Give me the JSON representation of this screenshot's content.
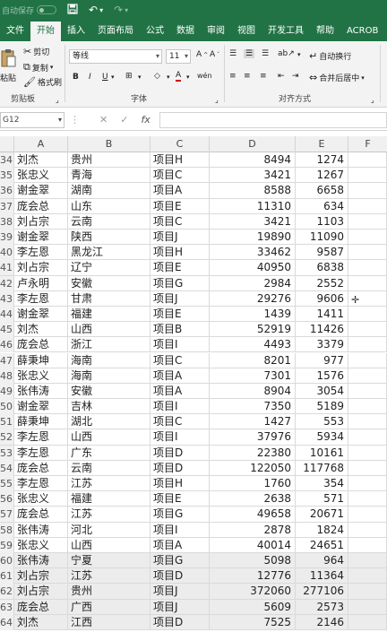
{
  "title_bar": {
    "autosave_label": "自动保存",
    "autosave_state": "关",
    "icons": [
      "save-icon",
      "undo-icon",
      "redo-icon"
    ]
  },
  "tabs": [
    "文件",
    "开始",
    "插入",
    "页面布局",
    "公式",
    "数据",
    "审阅",
    "视图",
    "开发工具",
    "帮助",
    "ACROB"
  ],
  "active_tab": "开始",
  "ribbon": {
    "clipboard": {
      "paste": "粘贴",
      "cut": "剪切",
      "copy": "复制",
      "format_painter": "格式刷",
      "label": "剪贴板"
    },
    "font": {
      "name": "等线",
      "size": "11",
      "label": "字体"
    },
    "alignment": {
      "wrap": "自动换行",
      "merge": "合并后居中",
      "label": "对齐方式"
    }
  },
  "formula_bar": {
    "name_box": "G12",
    "fx": "fx"
  },
  "columns": [
    "A",
    "B",
    "C",
    "D",
    "E",
    "F"
  ],
  "rows": [
    {
      "n": "34",
      "a": "刘杰",
      "b": "贵州",
      "c": "项目H",
      "d": "8494",
      "e": "1274",
      "shade": false
    },
    {
      "n": "35",
      "a": "张忠义",
      "b": "青海",
      "c": "项目C",
      "d": "3421",
      "e": "1267",
      "shade": false
    },
    {
      "n": "36",
      "a": "谢金翠",
      "b": "湖南",
      "c": "项目A",
      "d": "8588",
      "e": "6658",
      "shade": false
    },
    {
      "n": "37",
      "a": "庞会总",
      "b": "山东",
      "c": "项目E",
      "d": "11310",
      "e": "634",
      "shade": false
    },
    {
      "n": "38",
      "a": "刘占宗",
      "b": "云南",
      "c": "项目C",
      "d": "3421",
      "e": "1103",
      "shade": false
    },
    {
      "n": "39",
      "a": "谢金翠",
      "b": "陕西",
      "c": "项目J",
      "d": "19890",
      "e": "11090",
      "shade": false
    },
    {
      "n": "40",
      "a": "李左恩",
      "b": "黑龙江",
      "c": "项目H",
      "d": "33462",
      "e": "9587",
      "shade": false
    },
    {
      "n": "41",
      "a": "刘占宗",
      "b": "辽宁",
      "c": "项目E",
      "d": "40950",
      "e": "6838",
      "shade": false
    },
    {
      "n": "42",
      "a": "卢永明",
      "b": "安徽",
      "c": "项目G",
      "d": "2984",
      "e": "2552",
      "shade": false
    },
    {
      "n": "43",
      "a": "李左恩",
      "b": "甘肃",
      "c": "项目J",
      "d": "29276",
      "e": "9606",
      "shade": false
    },
    {
      "n": "44",
      "a": "谢金翠",
      "b": "福建",
      "c": "项目E",
      "d": "1439",
      "e": "1411",
      "shade": false
    },
    {
      "n": "45",
      "a": "刘杰",
      "b": "山西",
      "c": "项目B",
      "d": "52919",
      "e": "11426",
      "shade": false
    },
    {
      "n": "46",
      "a": "庞会总",
      "b": "浙江",
      "c": "项目I",
      "d": "4493",
      "e": "3379",
      "shade": false
    },
    {
      "n": "47",
      "a": "薛秉坤",
      "b": "海南",
      "c": "项目C",
      "d": "8201",
      "e": "977",
      "shade": false
    },
    {
      "n": "48",
      "a": "张忠义",
      "b": "海南",
      "c": "项目A",
      "d": "7301",
      "e": "1576",
      "shade": false
    },
    {
      "n": "49",
      "a": "张伟涛",
      "b": "安徽",
      "c": "项目A",
      "d": "8904",
      "e": "3054",
      "shade": false
    },
    {
      "n": "50",
      "a": "谢金翠",
      "b": "吉林",
      "c": "项目I",
      "d": "7350",
      "e": "5189",
      "shade": false
    },
    {
      "n": "51",
      "a": "薛秉坤",
      "b": "湖北",
      "c": "项目C",
      "d": "1427",
      "e": "553",
      "shade": false
    },
    {
      "n": "52",
      "a": "李左恩",
      "b": "山西",
      "c": "项目I",
      "d": "37976",
      "e": "5934",
      "shade": false
    },
    {
      "n": "53",
      "a": "李左恩",
      "b": "广东",
      "c": "项目D",
      "d": "22380",
      "e": "10161",
      "shade": false
    },
    {
      "n": "54",
      "a": "庞会总",
      "b": "云南",
      "c": "项目D",
      "d": "122050",
      "e": "117768",
      "shade": false
    },
    {
      "n": "55",
      "a": "李左恩",
      "b": "江苏",
      "c": "项目H",
      "d": "1760",
      "e": "354",
      "shade": false
    },
    {
      "n": "56",
      "a": "张忠义",
      "b": "福建",
      "c": "项目E",
      "d": "2638",
      "e": "571",
      "shade": false
    },
    {
      "n": "57",
      "a": "庞会总",
      "b": "江苏",
      "c": "项目G",
      "d": "49658",
      "e": "20671",
      "shade": false
    },
    {
      "n": "58",
      "a": "张伟涛",
      "b": "河北",
      "c": "项目I",
      "d": "2878",
      "e": "1824",
      "shade": false
    },
    {
      "n": "59",
      "a": "张忠义",
      "b": "山西",
      "c": "项目A",
      "d": "40014",
      "e": "24651",
      "shade": false
    },
    {
      "n": "60",
      "a": "张伟涛",
      "b": "宁夏",
      "c": "项目G",
      "d": "5098",
      "e": "964",
      "shade": true
    },
    {
      "n": "61",
      "a": "刘占宗",
      "b": "江苏",
      "c": "项目D",
      "d": "12776",
      "e": "11364",
      "shade": true
    },
    {
      "n": "62",
      "a": "刘占宗",
      "b": "贵州",
      "c": "项目J",
      "d": "372060",
      "e": "277106",
      "shade": true
    },
    {
      "n": "63",
      "a": "庞会总",
      "b": "广西",
      "c": "项目J",
      "d": "5609",
      "e": "2573",
      "shade": true
    },
    {
      "n": "64",
      "a": "刘杰",
      "b": "江西",
      "c": "项目D",
      "d": "7525",
      "e": "2146",
      "shade": true
    }
  ]
}
